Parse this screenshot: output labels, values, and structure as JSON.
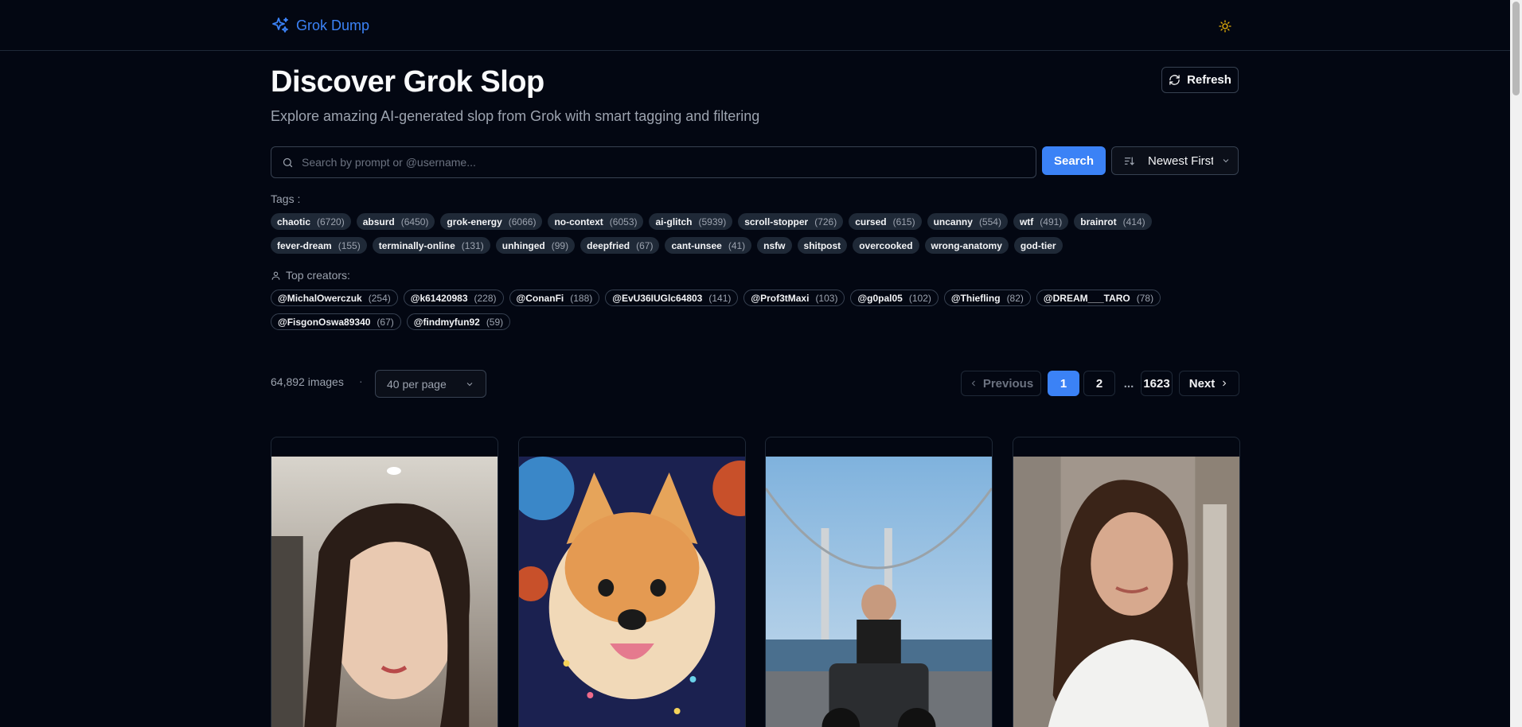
{
  "header": {
    "app_name": "Grok Dump",
    "logo_icon": "sparkles-icon",
    "theme_icon": "sun-icon"
  },
  "hero": {
    "title": "Discover Grok Slop",
    "subtitle": "Explore amazing AI-generated slop from Grok with smart tagging and filtering",
    "refresh_label": "Refresh"
  },
  "search": {
    "placeholder": "Search by prompt or @username...",
    "value": "",
    "button_label": "Search",
    "sort_value": "Newest First"
  },
  "tags": {
    "label": "Tags :",
    "items": [
      {
        "name": "chaotic",
        "count": "(6720)"
      },
      {
        "name": "absurd",
        "count": "(6450)"
      },
      {
        "name": "grok-energy",
        "count": "(6066)"
      },
      {
        "name": "no-context",
        "count": "(6053)"
      },
      {
        "name": "ai-glitch",
        "count": "(5939)"
      },
      {
        "name": "scroll-stopper",
        "count": "(726)"
      },
      {
        "name": "cursed",
        "count": "(615)"
      },
      {
        "name": "uncanny",
        "count": "(554)"
      },
      {
        "name": "wtf",
        "count": "(491)"
      },
      {
        "name": "brainrot",
        "count": "(414)"
      },
      {
        "name": "fever-dream",
        "count": "(155)"
      },
      {
        "name": "terminally-online",
        "count": "(131)"
      },
      {
        "name": "unhinged",
        "count": "(99)"
      },
      {
        "name": "deepfried",
        "count": "(67)"
      },
      {
        "name": "cant-unsee",
        "count": "(41)"
      },
      {
        "name": "nsfw",
        "count": ""
      },
      {
        "name": "shitpost",
        "count": ""
      },
      {
        "name": "overcooked",
        "count": ""
      },
      {
        "name": "wrong-anatomy",
        "count": ""
      },
      {
        "name": "god-tier",
        "count": ""
      }
    ]
  },
  "creators": {
    "label": "Top creators:",
    "items": [
      {
        "name": "@MichalOwerczuk",
        "count": "(254)"
      },
      {
        "name": "@k61420983",
        "count": "(228)"
      },
      {
        "name": "@ConanFi",
        "count": "(188)"
      },
      {
        "name": "@EvU36IUGlc64803",
        "count": "(141)"
      },
      {
        "name": "@Prof3tMaxi",
        "count": "(103)"
      },
      {
        "name": "@g0pal05",
        "count": "(102)"
      },
      {
        "name": "@Thiefling",
        "count": "(82)"
      },
      {
        "name": "@DREAM___TARO",
        "count": "(78)"
      },
      {
        "name": "@FisgonOswa89340",
        "count": "(67)"
      },
      {
        "name": "@findmyfun92",
        "count": "(59)"
      }
    ]
  },
  "results": {
    "count_label": "64,892 images",
    "separator": "·",
    "per_page": "40 per page"
  },
  "pagination": {
    "previous": "Previous",
    "page1": "1",
    "page2": "2",
    "ellipsis": "...",
    "last": "1623",
    "next": "Next"
  },
  "colors": {
    "accent": "#3b82f6",
    "background": "#030712",
    "theme_icon": "#eab308"
  }
}
